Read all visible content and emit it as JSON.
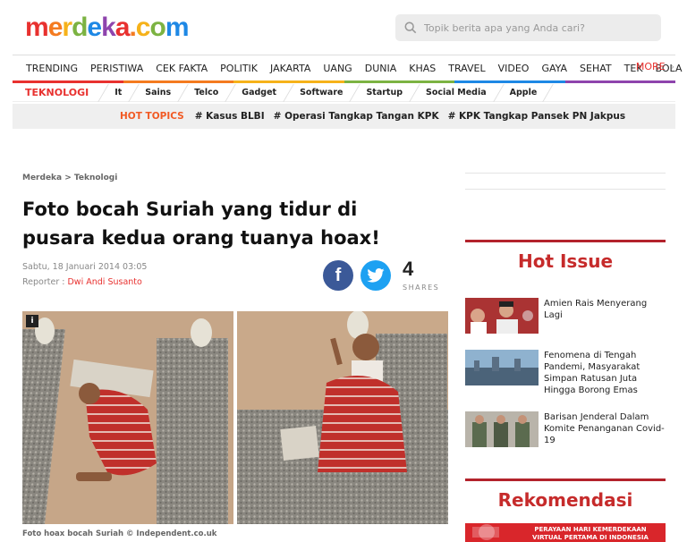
{
  "header": {
    "logo": {
      "merdeka": "merdeka",
      "dot": ".",
      "com": "com"
    },
    "search_placeholder": "Topik berita apa yang Anda cari?"
  },
  "mainnav": {
    "items": [
      "TRENDING",
      "PERISTIWA",
      "CEK FAKTA",
      "POLITIK",
      "JAKARTA",
      "UANG",
      "DUNIA",
      "KHAS",
      "TRAVEL",
      "VIDEO",
      "GAYA",
      "SEHAT",
      "TEK",
      "BOLA"
    ],
    "more": "MORE",
    "colors": [
      "#e8312f",
      "#f47b20",
      "#f6b21a",
      "#7cb342",
      "#1e88e5",
      "#8e44ad"
    ]
  },
  "subnav": {
    "category": "TEKNOLOGI",
    "items": [
      "It",
      "Sains",
      "Telco",
      "Gadget",
      "Software",
      "Startup",
      "Social Media",
      "Apple"
    ]
  },
  "hot_topics": {
    "label": "HOT TOPICS",
    "tags": [
      "# Kasus BLBI",
      "# Operasi Tangkap Tangan KPK",
      "# KPK Tangkap Pansek PN Jakpus"
    ]
  },
  "article": {
    "breadcrumb": "Merdeka > Teknologi",
    "title": "Foto bocah Suriah yang tidur di pusara kedua orang tuanya hoax!",
    "date": "Sabtu, 18 Januari 2014 03:05",
    "reporter_label": "Reporter : ",
    "reporter_name": "Dwi Andi Susanto",
    "share_count": "4",
    "share_label": "SHARES",
    "info_badge": "i",
    "caption": "Foto hoax bocah Suriah © Independent.co.uk"
  },
  "sidebar": {
    "hot_issue_title": "Hot Issue",
    "hot_issue_items": [
      "Amien Rais Menyerang Lagi",
      "Fenomena di Tengah Pandemi, Masyarakat Simpan Ratusan Juta Hingga Borong Emas",
      "Barisan Jenderal Dalam Komite Penanganan Covid-19"
    ],
    "rekomendasi_title": "Rekomendasi",
    "banner_text": "PERAYAAN HARI KEMERDEKAAN VIRTUAL PERTAMA DI INDONESIA"
  },
  "icons": {
    "search": "search-icon",
    "chevron": "chevron-right-icon",
    "facebook": "facebook-icon",
    "twitter": "twitter-icon"
  }
}
